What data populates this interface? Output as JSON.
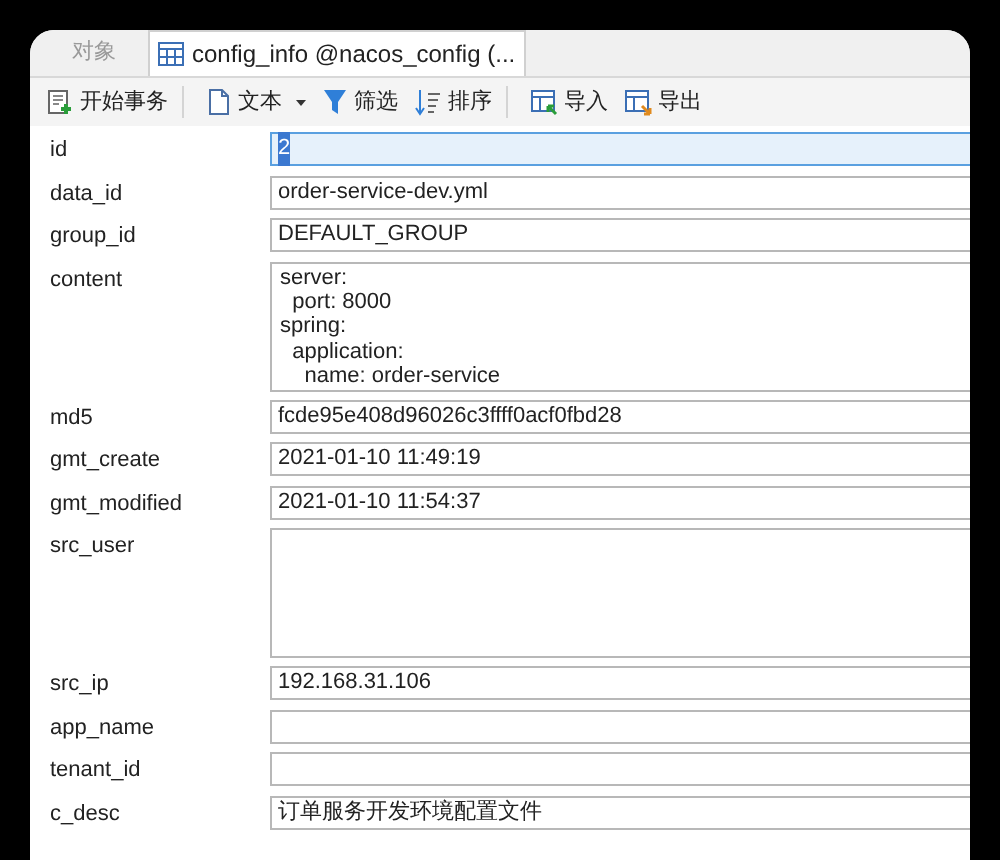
{
  "tabs": [
    {
      "label": "对象",
      "selected": false,
      "icon": false
    },
    {
      "label": "config_info @nacos_config (...",
      "selected": true,
      "icon": true
    }
  ],
  "toolbar_groups": [
    [
      {
        "label": "开始事务",
        "kind": "transaction",
        "caret": false
      }
    ],
    [
      {
        "label": "文本",
        "kind": "text",
        "caret": true
      },
      {
        "label": "筛选",
        "kind": "filter",
        "caret": false
      },
      {
        "label": "排序",
        "kind": "sort",
        "caret": false
      }
    ],
    [
      {
        "label": "导入",
        "kind": "import",
        "caret": false
      },
      {
        "label": "导出",
        "kind": "export",
        "caret": false
      }
    ]
  ],
  "fields": [
    {
      "label": "id",
      "value": "2",
      "kind": "line",
      "focused": true
    },
    {
      "label": "data_id",
      "value": "order-service-dev.yml",
      "kind": "line",
      "focused": false
    },
    {
      "label": "group_id",
      "value": "DEFAULT_GROUP",
      "kind": "line",
      "focused": false
    },
    {
      "label": "content",
      "lines": [
        "server:",
        "  port: 8000",
        "spring:",
        "  application:",
        "    name: order-service"
      ],
      "kind": "multiline",
      "focused": false
    },
    {
      "label": "md5",
      "value": "fcde95e408d96026c3ffff0acf0fbd28",
      "kind": "line",
      "focused": false
    },
    {
      "label": "gmt_create",
      "value": "2021-01-10 11:49:19",
      "kind": "line",
      "focused": false
    },
    {
      "label": "gmt_modified",
      "value": "2021-01-10 11:54:37",
      "kind": "line",
      "focused": false
    },
    {
      "label": "src_user",
      "kind": "multiline",
      "focused": false
    },
    {
      "label": "src_ip",
      "value": "192.168.31.106",
      "kind": "line",
      "focused": false
    },
    {
      "label": "app_name",
      "kind": "line",
      "focused": false
    },
    {
      "label": "tenant_id",
      "kind": "line",
      "focused": false
    },
    {
      "label": "c_desc",
      "value": "订单服务开发环境配置文件",
      "kind": "line",
      "focused": false
    }
  ]
}
